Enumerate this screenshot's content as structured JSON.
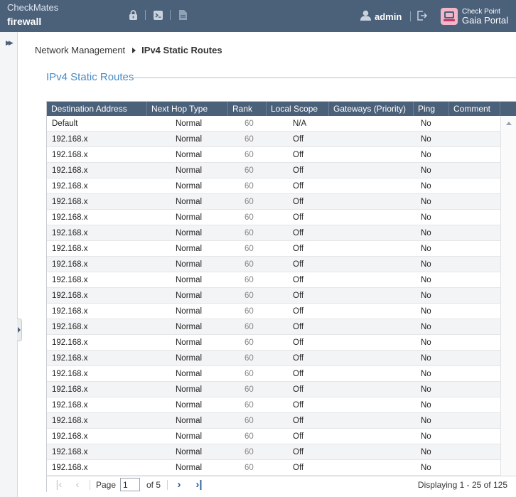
{
  "header": {
    "org": "CheckMates",
    "host": "firewall",
    "user": "admin",
    "logo_line1": "Check Point",
    "logo_line2": "Gaia Portal",
    "icons": [
      "lock-icon",
      "terminal-icon",
      "document-icon",
      "user-icon",
      "logout-icon"
    ]
  },
  "breadcrumb": {
    "parent": "Network Management",
    "current": "IPv4 Static Routes"
  },
  "section": {
    "title": "IPv4 Static Routes"
  },
  "table": {
    "columns": [
      "Destination Address",
      "Next Hop Type",
      "Rank",
      "Local Scope",
      "Gateways (Priority)",
      "Ping",
      "Comment"
    ],
    "rows": [
      {
        "dest": "Default",
        "hop": "Normal",
        "rank": "60",
        "scope": "N/A",
        "gw": "",
        "ping": "No",
        "comment": ""
      },
      {
        "dest": "192.168.x",
        "hop": "Normal",
        "rank": "60",
        "scope": "Off",
        "gw": "",
        "ping": "No",
        "comment": ""
      },
      {
        "dest": "192.168.x",
        "hop": "Normal",
        "rank": "60",
        "scope": "Off",
        "gw": "",
        "ping": "No",
        "comment": ""
      },
      {
        "dest": "192.168.x",
        "hop": "Normal",
        "rank": "60",
        "scope": "Off",
        "gw": "",
        "ping": "No",
        "comment": ""
      },
      {
        "dest": "192.168.x",
        "hop": "Normal",
        "rank": "60",
        "scope": "Off",
        "gw": "",
        "ping": "No",
        "comment": ""
      },
      {
        "dest": "192.168.x",
        "hop": "Normal",
        "rank": "60",
        "scope": "Off",
        "gw": "",
        "ping": "No",
        "comment": ""
      },
      {
        "dest": "192.168.x",
        "hop": "Normal",
        "rank": "60",
        "scope": "Off",
        "gw": "",
        "ping": "No",
        "comment": ""
      },
      {
        "dest": "192.168.x",
        "hop": "Normal",
        "rank": "60",
        "scope": "Off",
        "gw": "",
        "ping": "No",
        "comment": ""
      },
      {
        "dest": "192.168.x",
        "hop": "Normal",
        "rank": "60",
        "scope": "Off",
        "gw": "",
        "ping": "No",
        "comment": ""
      },
      {
        "dest": "192.168.x",
        "hop": "Normal",
        "rank": "60",
        "scope": "Off",
        "gw": "",
        "ping": "No",
        "comment": ""
      },
      {
        "dest": "192.168.x",
        "hop": "Normal",
        "rank": "60",
        "scope": "Off",
        "gw": "",
        "ping": "No",
        "comment": ""
      },
      {
        "dest": "192.168.x",
        "hop": "Normal",
        "rank": "60",
        "scope": "Off",
        "gw": "",
        "ping": "No",
        "comment": ""
      },
      {
        "dest": "192.168.x",
        "hop": "Normal",
        "rank": "60",
        "scope": "Off",
        "gw": "",
        "ping": "No",
        "comment": ""
      },
      {
        "dest": "192.168.x",
        "hop": "Normal",
        "rank": "60",
        "scope": "Off",
        "gw": "",
        "ping": "No",
        "comment": ""
      },
      {
        "dest": "192.168.x",
        "hop": "Normal",
        "rank": "60",
        "scope": "Off",
        "gw": "",
        "ping": "No",
        "comment": ""
      },
      {
        "dest": "192.168.x",
        "hop": "Normal",
        "rank": "60",
        "scope": "Off",
        "gw": "",
        "ping": "No",
        "comment": ""
      },
      {
        "dest": "192.168.x",
        "hop": "Normal",
        "rank": "60",
        "scope": "Off",
        "gw": "",
        "ping": "No",
        "comment": ""
      },
      {
        "dest": "192.168.x",
        "hop": "Normal",
        "rank": "60",
        "scope": "Off",
        "gw": "",
        "ping": "No",
        "comment": ""
      },
      {
        "dest": "192.168.x",
        "hop": "Normal",
        "rank": "60",
        "scope": "Off",
        "gw": "",
        "ping": "No",
        "comment": ""
      },
      {
        "dest": "192.168.x",
        "hop": "Normal",
        "rank": "60",
        "scope": "Off",
        "gw": "",
        "ping": "No",
        "comment": ""
      },
      {
        "dest": "192.168.x",
        "hop": "Normal",
        "rank": "60",
        "scope": "Off",
        "gw": "",
        "ping": "No",
        "comment": ""
      },
      {
        "dest": "192.168.x",
        "hop": "Normal",
        "rank": "60",
        "scope": "Off",
        "gw": "",
        "ping": "No",
        "comment": ""
      },
      {
        "dest": "192.168.x",
        "hop": "Normal",
        "rank": "60",
        "scope": "Off",
        "gw": "",
        "ping": "No",
        "comment": ""
      }
    ]
  },
  "pager": {
    "page_label": "Page",
    "page_value": "1",
    "of_label": "of 5",
    "display": "Displaying 1 - 25 of 125"
  },
  "colors": {
    "header_bg": "#4b6079",
    "accent": "#4a8bc2"
  }
}
